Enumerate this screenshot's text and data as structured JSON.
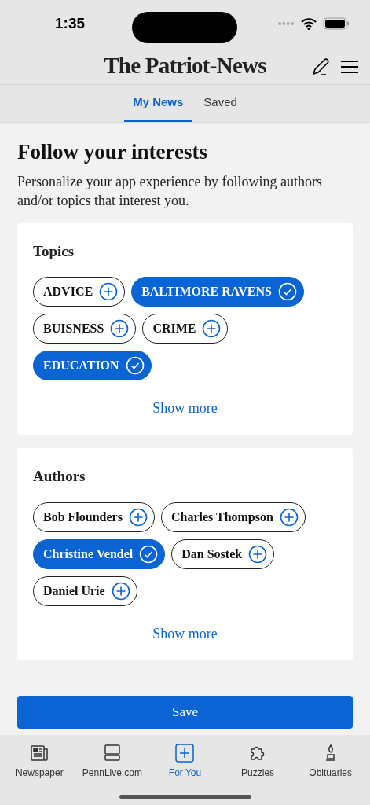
{
  "status_bar": {
    "time": "1:35"
  },
  "header": {
    "logo": "The Patriot-News"
  },
  "tabs": [
    {
      "label": "My News",
      "selected": true
    },
    {
      "label": "Saved",
      "selected": false
    }
  ],
  "intro": {
    "title": "Follow your interests",
    "text": "Personalize your app experience by following authors and/or topics that interest you."
  },
  "sections": [
    {
      "title": "Topics",
      "show_more": "Show more",
      "chips": [
        {
          "label": "ADVICE",
          "selected": false
        },
        {
          "label": "BALTIMORE RAVENS",
          "selected": true
        },
        {
          "label": "BUISNESS",
          "selected": false
        },
        {
          "label": "CRIME",
          "selected": false
        },
        {
          "label": "EDUCATION",
          "selected": true
        }
      ]
    },
    {
      "title": "Authors",
      "show_more": "Show more",
      "chips": [
        {
          "label": "Bob Flounders",
          "selected": false
        },
        {
          "label": "Charles Thompson",
          "selected": false
        },
        {
          "label": "Christine Vendel",
          "selected": true
        },
        {
          "label": "Dan Sostek",
          "selected": false
        },
        {
          "label": "Daniel Urie",
          "selected": false
        }
      ]
    }
  ],
  "save_button": "Save",
  "bottom_nav": [
    {
      "label": "Newspaper",
      "kind": "newspaper",
      "selected": false
    },
    {
      "label": "PennLive.com",
      "kind": "site",
      "selected": false
    },
    {
      "label": "For You",
      "kind": "plus",
      "selected": true
    },
    {
      "label": "Puzzles",
      "kind": "puzzle",
      "selected": false
    },
    {
      "label": "Obituaries",
      "kind": "candle",
      "selected": false
    }
  ]
}
